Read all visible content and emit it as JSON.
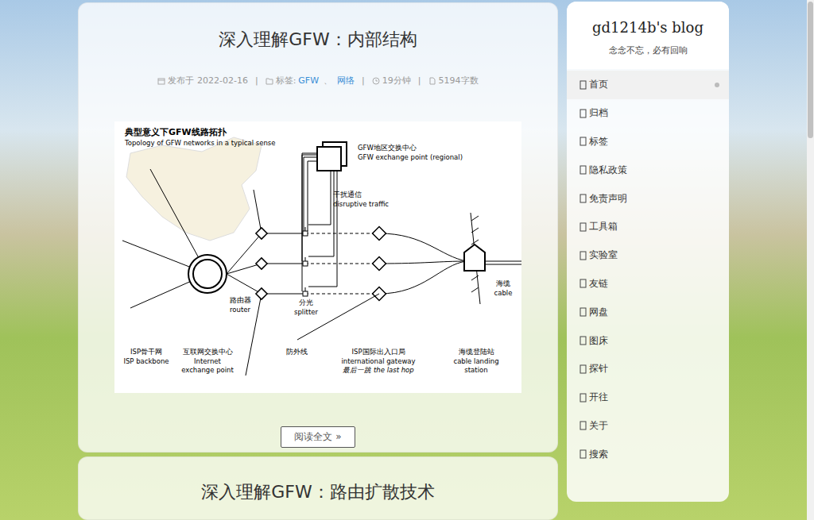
{
  "posts": [
    {
      "title": "深入理解GFW：内部结构",
      "meta": {
        "published_label": "发布于",
        "date": "2022-02-16",
        "separator": "|",
        "tags_label": "标签:",
        "tags": [
          "GFW",
          "网络"
        ],
        "tag_joiner": "、",
        "read_time": "19分钟",
        "word_count": "5194字数"
      },
      "diagram": {
        "title": "典型意义下GFW线路拓扑",
        "subtitle": "Topology of GFW networks in a typical sense",
        "labels": [
          {
            "lines": [
              "GFW地区交换中心",
              "GFW exchange point (regional)"
            ],
            "emphasis": false
          },
          {
            "lines": [
              "干扰通信",
              "disruptive traffic"
            ],
            "emphasis": false
          },
          {
            "lines": [
              "路由器",
              "router"
            ],
            "emphasis": false
          },
          {
            "lines": [
              "分光",
              "splitter"
            ],
            "emphasis": false
          },
          {
            "lines": [
              "海缆",
              "cable"
            ],
            "emphasis": false
          },
          {
            "lines": [
              "ISP骨干网",
              "ISP backbone"
            ],
            "emphasis": false
          },
          {
            "lines": [
              "互联网交换中心",
              "Internet",
              "exchange point"
            ],
            "emphasis": false
          },
          {
            "lines": [
              "防外线"
            ],
            "emphasis": false
          },
          {
            "lines": [
              "ISP国际出入口局",
              "international gateway",
              "最后一跳 the last hop"
            ],
            "emphasis": true
          },
          {
            "lines": [
              "海缆登陆站",
              "cable landing",
              "station"
            ],
            "emphasis": false
          }
        ]
      },
      "read_more": "阅读全文 »"
    },
    {
      "title": "深入理解GFW：路由扩散技术"
    }
  ],
  "sidebar": {
    "title": "gd1214b's blog",
    "subtitle": "念念不忘，必有回响",
    "items": [
      {
        "label": "首页",
        "selected": true
      },
      {
        "label": "归档",
        "selected": false
      },
      {
        "label": "标签",
        "selected": false
      },
      {
        "label": "隐私政策",
        "selected": false
      },
      {
        "label": "免责声明",
        "selected": false
      },
      {
        "label": "工具箱",
        "selected": false
      },
      {
        "label": "实验室",
        "selected": false
      },
      {
        "label": "友链",
        "selected": false
      },
      {
        "label": "网盘",
        "selected": false
      },
      {
        "label": "图床",
        "selected": false
      },
      {
        "label": "探针",
        "selected": false
      },
      {
        "label": "开往",
        "selected": false
      },
      {
        "label": "关于",
        "selected": false
      },
      {
        "label": "搜索",
        "selected": false
      }
    ]
  }
}
